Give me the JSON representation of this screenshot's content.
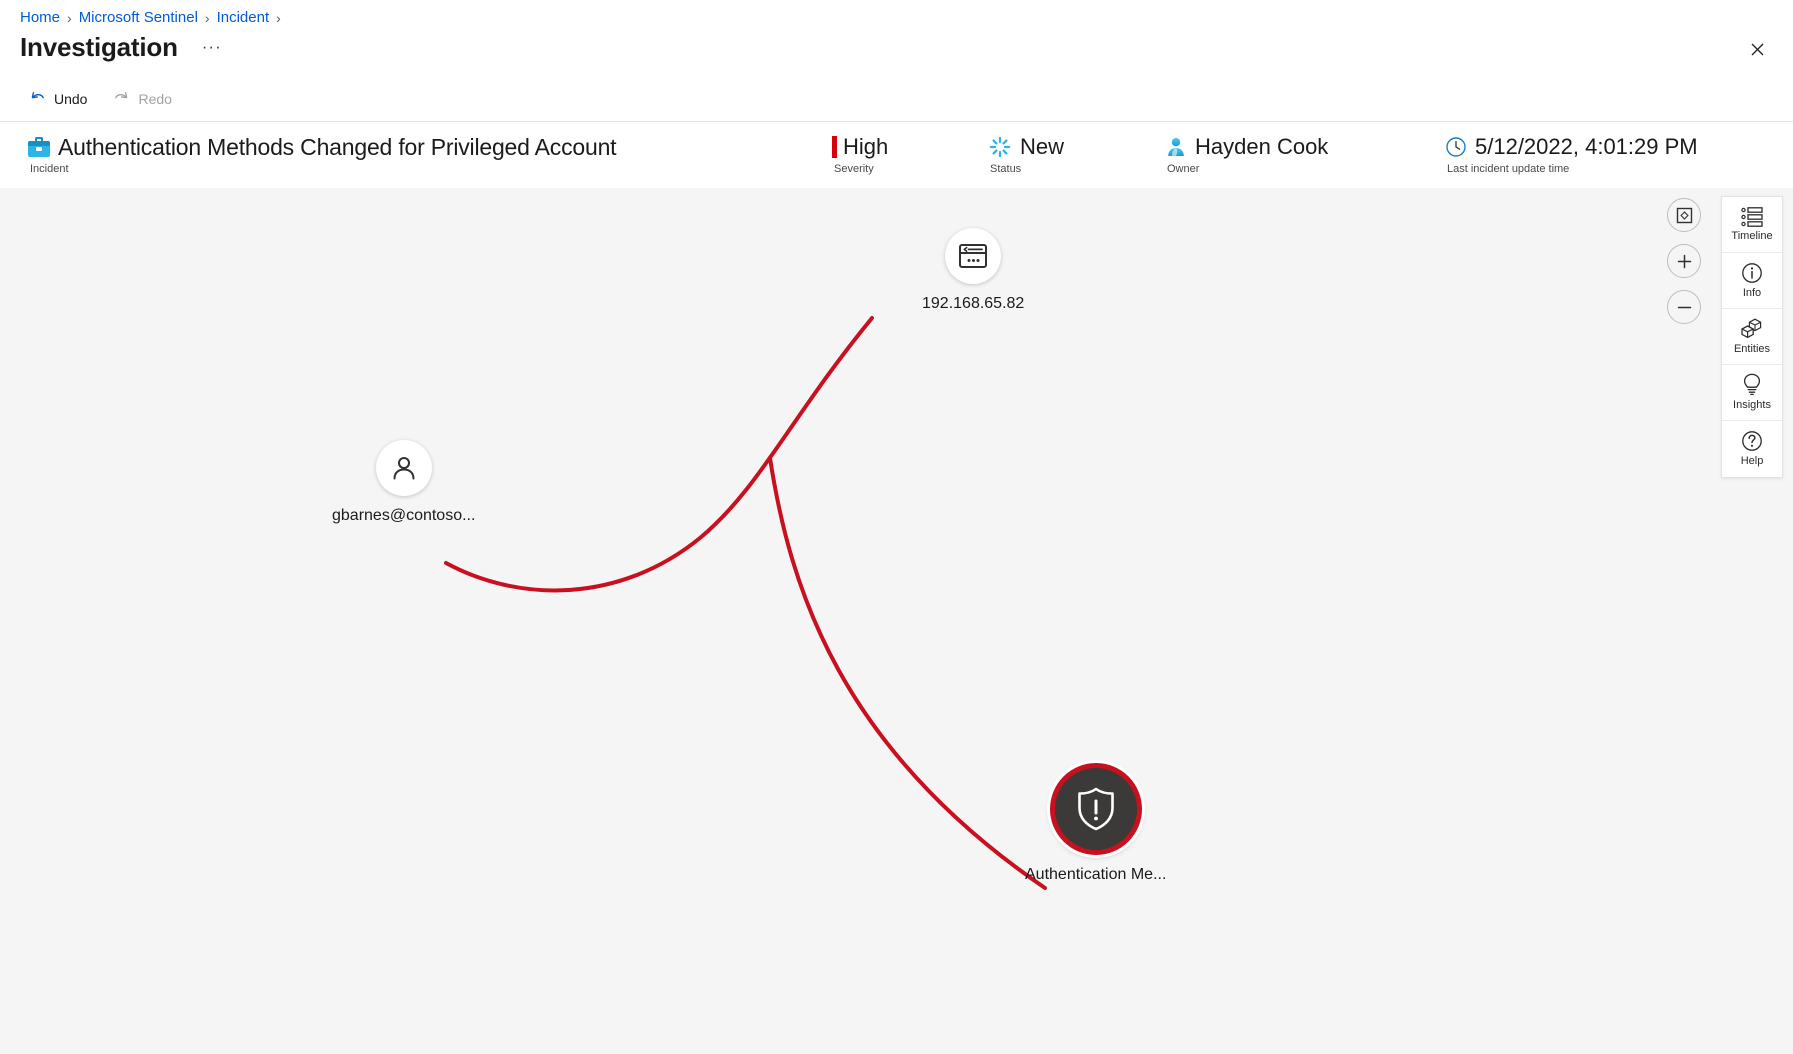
{
  "breadcrumb": {
    "items": [
      {
        "label": "Home"
      },
      {
        "label": "Microsoft Sentinel"
      },
      {
        "label": "Incident"
      }
    ],
    "separator": "›"
  },
  "header": {
    "title": "Investigation",
    "overflow_label": "···",
    "close_label": "✕"
  },
  "toolbar": {
    "undo_label": "Undo",
    "redo_label": "Redo"
  },
  "incident": {
    "title": "Authentication Methods Changed for Privileged Account",
    "title_sublabel": "Incident",
    "severity_value": "High",
    "severity_sublabel": "Severity",
    "severity_color": "#d6010a",
    "status_value": "New",
    "status_sublabel": "Status",
    "status_color": "#29b5e8",
    "owner_value": "Hayden Cook",
    "owner_sublabel": "Owner",
    "updated_value": "5/12/2022, 4:01:29 PM",
    "updated_sublabel": "Last incident update time"
  },
  "graph": {
    "edge_color": "#c8101e",
    "nodes": [
      {
        "id": "ip",
        "label": "192.168.65.82",
        "icon": "host-window-icon",
        "selected": false
      },
      {
        "id": "account",
        "label": "gbarnes@contoso...",
        "icon": "account-person-icon",
        "selected": false
      },
      {
        "id": "incident",
        "label": "Authentication Me...",
        "icon": "incident-shield-icon",
        "selected": true
      }
    ]
  },
  "zoom_controls": [
    {
      "name": "fit-to-screen",
      "label": ""
    },
    {
      "name": "zoom-in",
      "label": "+"
    },
    {
      "name": "zoom-out",
      "label": "−"
    }
  ],
  "tool_rail": {
    "items": [
      {
        "id": "timeline",
        "label": "Timeline"
      },
      {
        "id": "info",
        "label": "Info"
      },
      {
        "id": "entities",
        "label": "Entities"
      },
      {
        "id": "insights",
        "label": "Insights"
      },
      {
        "id": "help",
        "label": "Help"
      }
    ]
  }
}
